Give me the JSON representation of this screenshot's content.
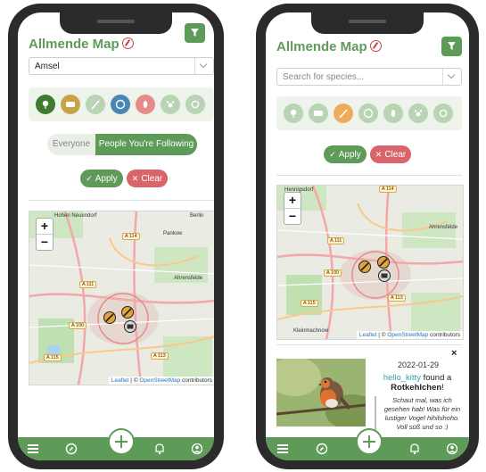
{
  "app": {
    "title": "Allmende Map"
  },
  "left": {
    "species_value": "Amsel",
    "toggle": {
      "everyone": "Everyone",
      "following": "People You're Following"
    },
    "apply_label": "Apply",
    "clear_label": "Clear"
  },
  "right": {
    "species_placeholder": "Search for species...",
    "apply_label": "Apply",
    "clear_label": "Clear",
    "close_label": "×",
    "sighting": {
      "date": "2022-01-29",
      "user": "hello_kitty",
      "found_text": " found a ",
      "bird": "Rotkehlchen",
      "exclaim": "!",
      "quote": "Schaut mal, was ich gesehen hab! Was für ein lustiger Vogel hihihihoho. Voll süß und so :)"
    }
  },
  "map": {
    "zoom_in": "+",
    "zoom_out": "−",
    "attr_leaflet": "Leaflet",
    "attr_sep": " | © ",
    "attr_osm": "OpenStreetMap",
    "attr_contrib": " contributors",
    "labels": {
      "hohen": "Hohen Neuendorf",
      "berlin": "Berlin",
      "pankow": "Pankow",
      "ahrensfelde": "Ahrensfelde",
      "hennigsdorf": "Hennigsdorf",
      "kleinmachnow": "Kleinmachnow",
      "a114": "A 114",
      "a111": "A 111",
      "a100": "A 100",
      "a115": "A 115",
      "a113": "A 113"
    }
  },
  "colors": {
    "brand": "#5e9b58",
    "apply": "#5e9b58",
    "clear": "#d9646a",
    "link": "#2a79c6"
  },
  "icons": {
    "menu": "menu-icon",
    "explore": "compass-icon",
    "add": "plus-icon",
    "notifications": "bell-icon",
    "profile": "user-circle-icon"
  }
}
